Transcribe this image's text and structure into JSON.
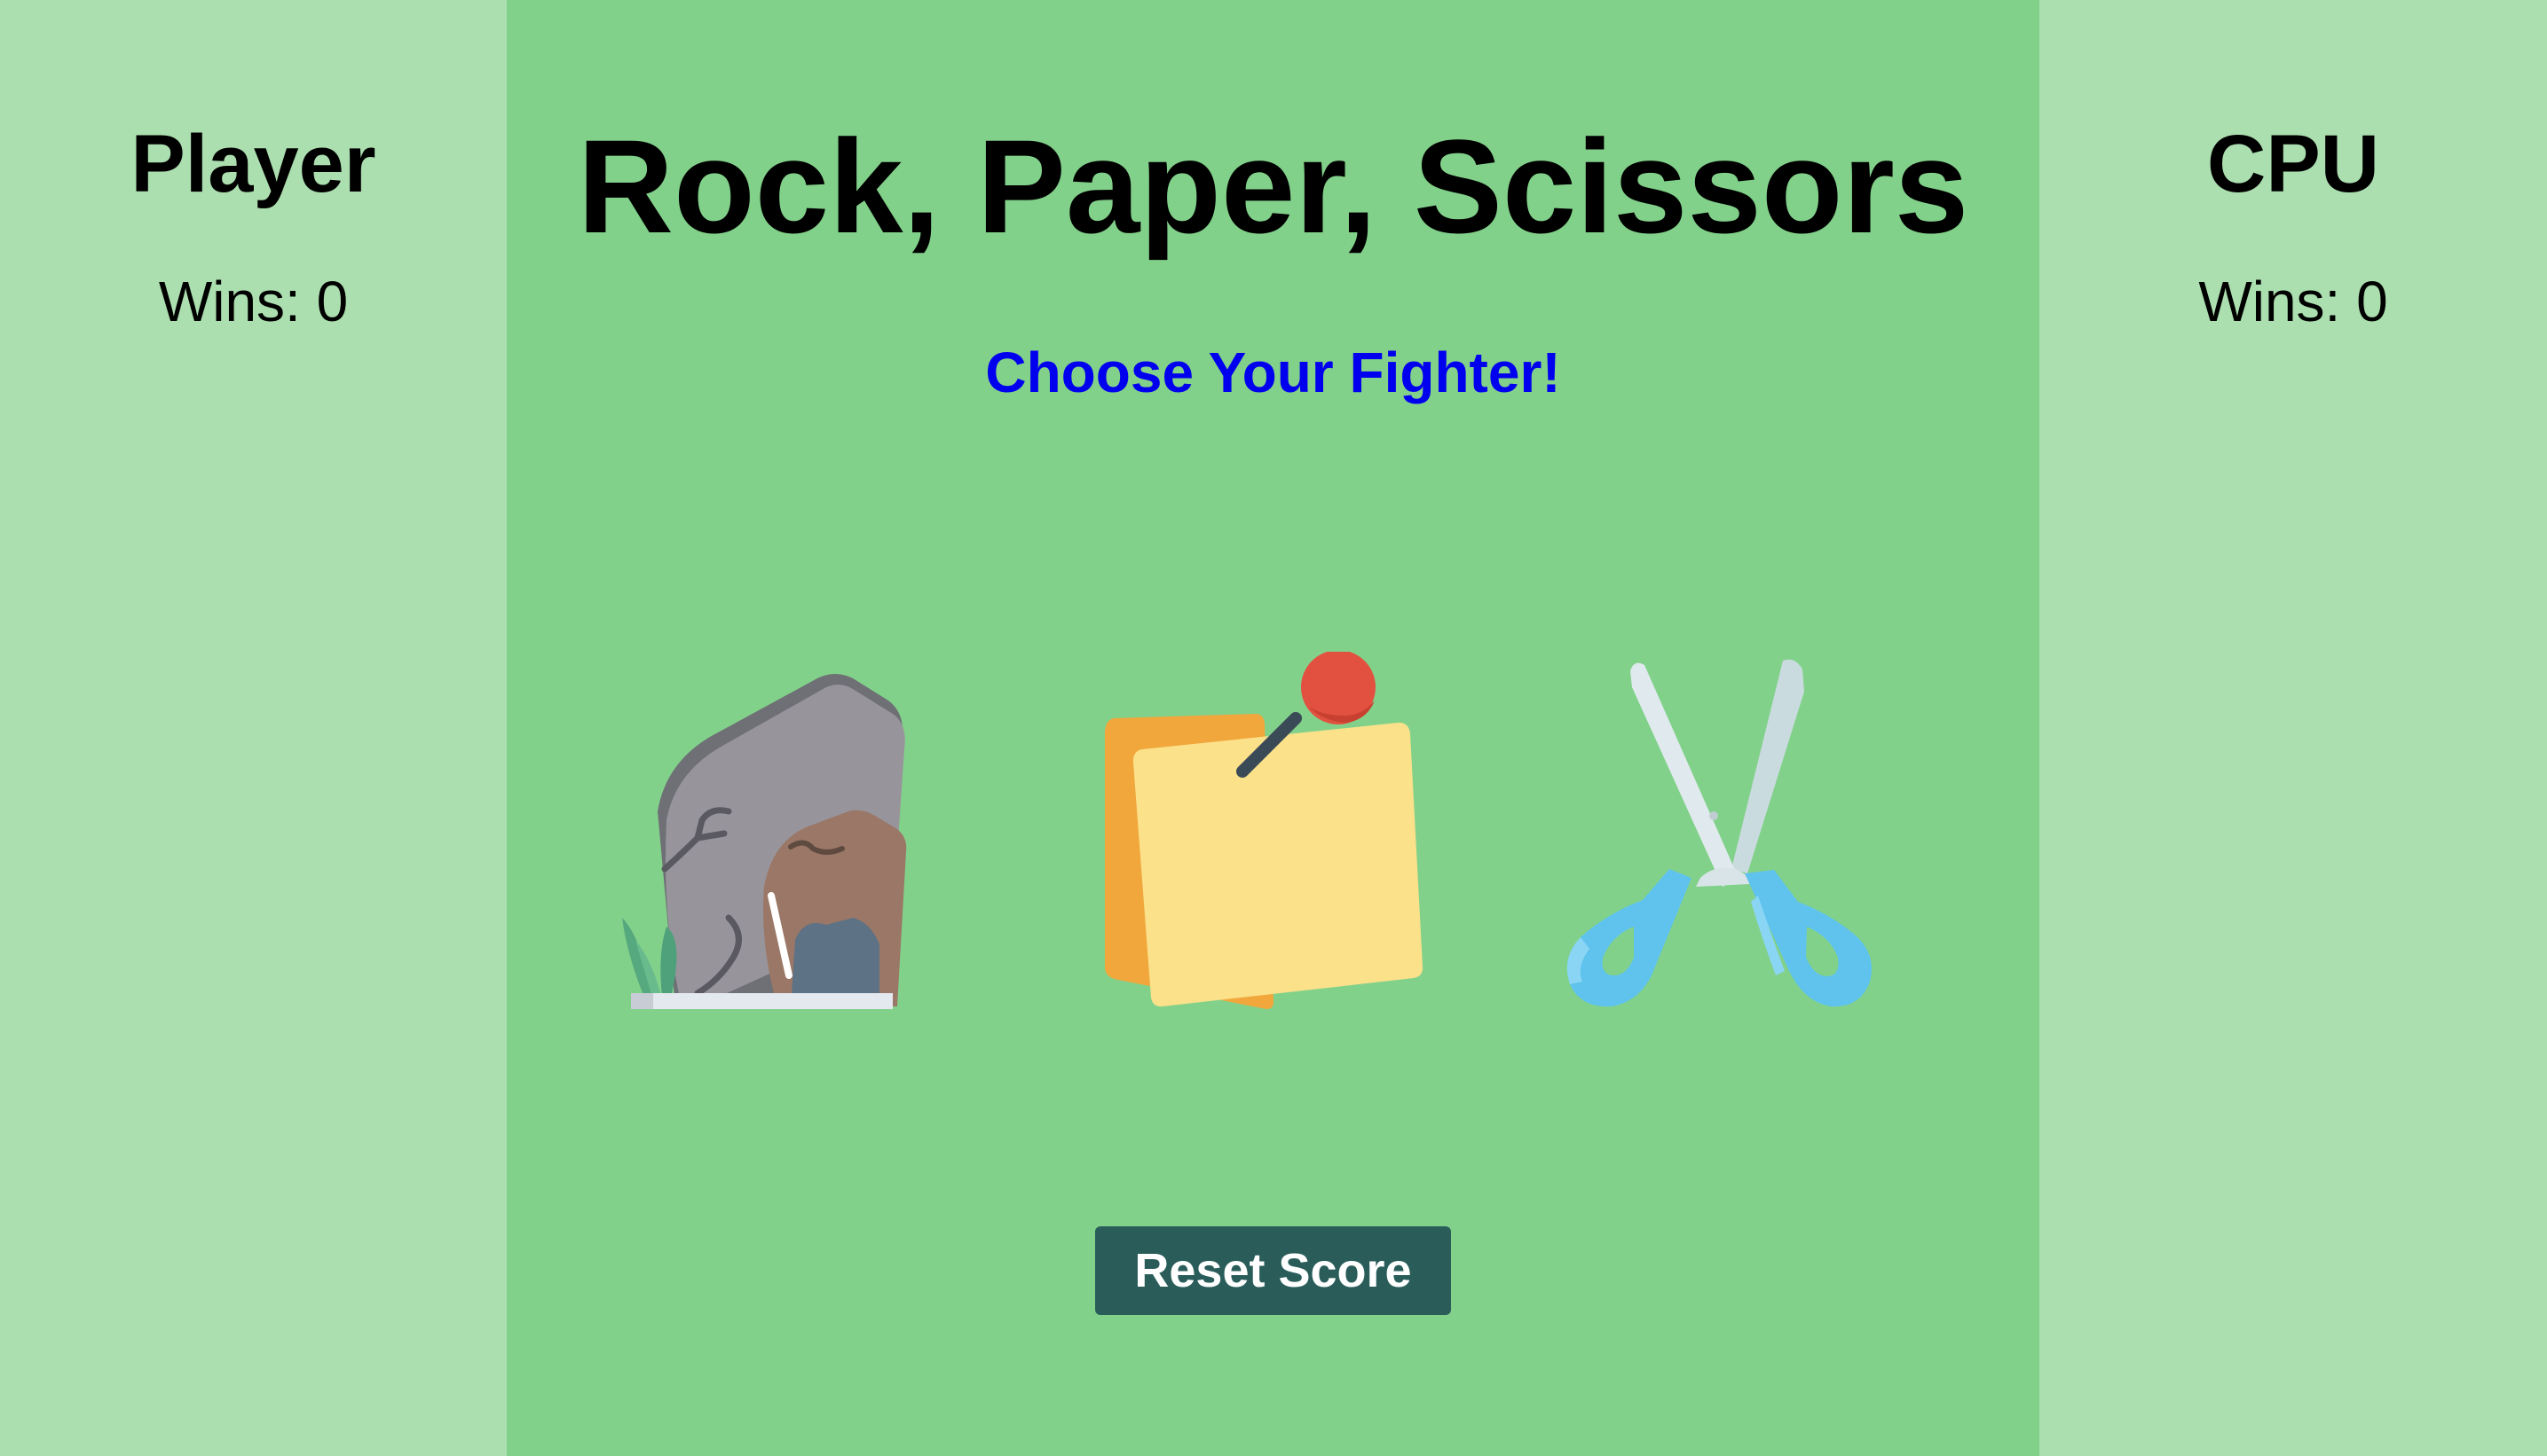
{
  "player": {
    "title": "Player",
    "wins_label": "Wins:",
    "wins": "0"
  },
  "cpu": {
    "title": "CPU",
    "wins_label": "Wins:",
    "wins": "0"
  },
  "game": {
    "title": "Rock, Paper, Scissors",
    "prompt": "Choose Your Fighter!",
    "prompt_color": "#0000ee",
    "choices": [
      {
        "id": "rock",
        "icon": "rock-icon"
      },
      {
        "id": "paper",
        "icon": "paper-icon"
      },
      {
        "id": "scissors",
        "icon": "scissors-icon"
      }
    ],
    "reset_label": "Reset Score"
  },
  "colors": {
    "side_bg": "#acdfb0",
    "center_bg": "#82d18a",
    "reset_bg": "#2a5d5a"
  }
}
